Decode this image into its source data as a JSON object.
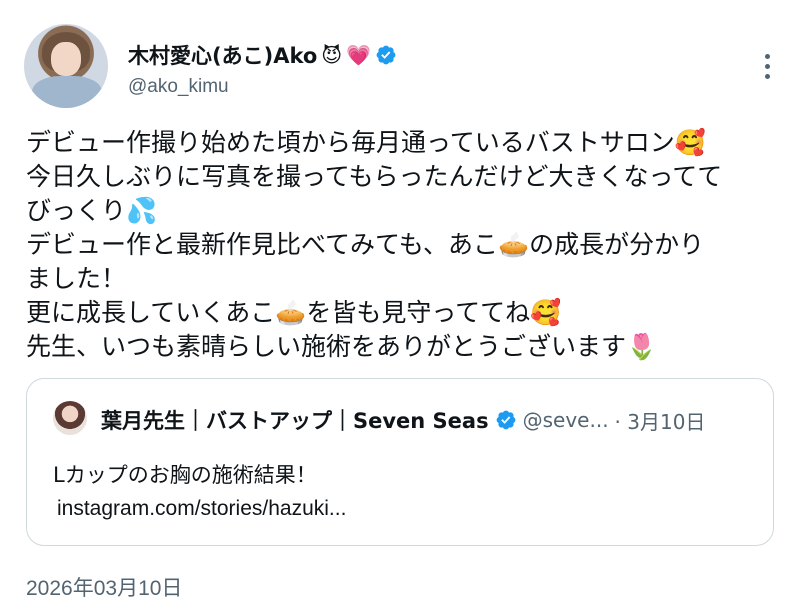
{
  "author": {
    "display_name": "木村愛心(あこ)Ako",
    "name_emojis": [
      "😈",
      "💗"
    ],
    "handle": "@ako_kimu",
    "verified": true
  },
  "tweet": {
    "lines": [
      "デビュー作撮り始めた頃から毎月通っているバストサロン🥰",
      "今日久しぶりに写真を撮ってもらったんだけど大きくなってて",
      "びっくり💦",
      "デビュー作と最新作見比べてみても、あこ🥧の成長が分かり",
      "ました！",
      "更に成長していくあこ🥧を皆も見守っててね🥰",
      "先生、いつも素晴らしい施術をありがとうございます🌷"
    ]
  },
  "quote": {
    "display_name": "葉月先生｜バストアップ｜Seven Seas",
    "verified": true,
    "handle": "@seve...",
    "date": "· 3月10日",
    "body": "Lカップのお胸の施術結果！",
    "link": "instagram.com/stories/hazuki..."
  },
  "timestamp": "2026年03月10日",
  "colors": {
    "verified_blue": "#1d9bf0",
    "secondary_text": "#536471",
    "border": "#cfd9de"
  },
  "icons": {
    "more": "more-vertical-icon",
    "verified": "verified-badge-icon"
  }
}
